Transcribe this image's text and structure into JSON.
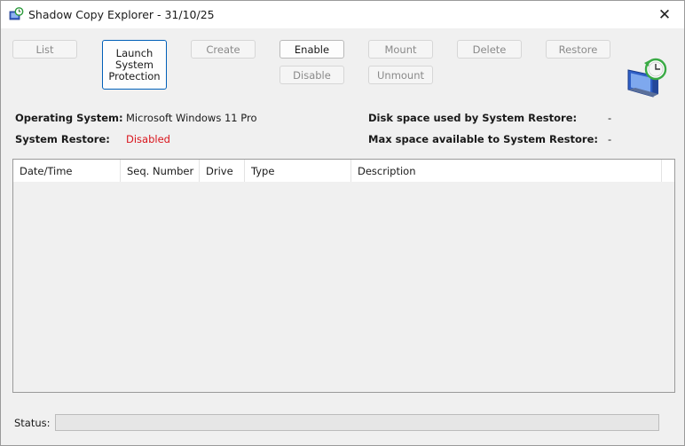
{
  "window": {
    "title": "Shadow Copy Explorer - 31/10/25",
    "close_glyph": "✕"
  },
  "toolbar": {
    "list": "List",
    "launch": "Launch\nSystem\nProtection",
    "create": "Create",
    "enable": "Enable",
    "disable": "Disable",
    "mount": "Mount",
    "unmount": "Unmount",
    "delete": "Delete",
    "restore": "Restore"
  },
  "info": {
    "os_label": "Operating System:",
    "os_value": "Microsoft Windows 11 Pro",
    "sr_label": "System Restore:",
    "sr_value": "Disabled",
    "disk_used_label": "Disk space used by System Restore:",
    "disk_used_value": "-",
    "max_space_label": "Max space available to System Restore:",
    "max_space_value": "-"
  },
  "table": {
    "columns": [
      "Date/Time",
      "Seq. Number",
      "Drive",
      "Type",
      "Description"
    ],
    "rows": []
  },
  "status": {
    "label": "Status:",
    "text": ""
  },
  "colors": {
    "accent": "#005fb8",
    "disabled_text": "#d9141c"
  },
  "icons": {
    "app": "restore-point-icon",
    "banner": "system-restore-icon"
  }
}
